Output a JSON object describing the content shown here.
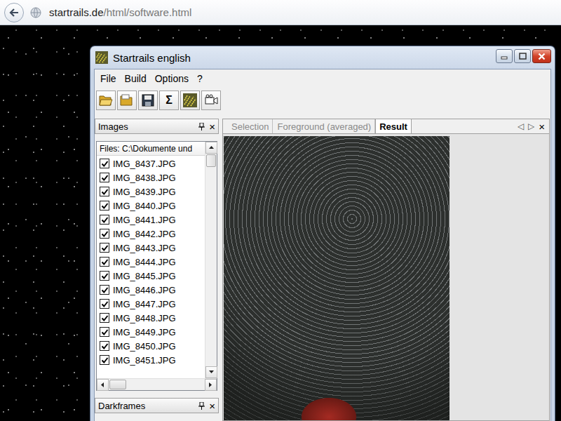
{
  "browser": {
    "url_host": "startrails.de",
    "url_path": "/html/software.html"
  },
  "window": {
    "title": "Startrails english"
  },
  "menu": [
    "File",
    "Build",
    "Options",
    "?"
  ],
  "toolbar": [
    {
      "kind": "open"
    },
    {
      "kind": "open-multiple"
    },
    {
      "kind": "save"
    },
    {
      "kind": "sum",
      "label": "Σ"
    },
    {
      "kind": "build"
    },
    {
      "kind": "video"
    }
  ],
  "images_panel": {
    "title": "Images",
    "close": "×",
    "files_header": "Files: C:\\Dokumente und",
    "files": [
      {
        "name": "IMG_8437.JPG",
        "checked": true
      },
      {
        "name": "IMG_8438.JPG",
        "checked": true
      },
      {
        "name": "IMG_8439.JPG",
        "checked": true
      },
      {
        "name": "IMG_8440.JPG",
        "checked": true
      },
      {
        "name": "IMG_8441.JPG",
        "checked": true
      },
      {
        "name": "IMG_8442.JPG",
        "checked": true
      },
      {
        "name": "IMG_8443.JPG",
        "checked": true
      },
      {
        "name": "IMG_8444.JPG",
        "checked": true
      },
      {
        "name": "IMG_8445.JPG",
        "checked": true
      },
      {
        "name": "IMG_8446.JPG",
        "checked": true
      },
      {
        "name": "IMG_8447.JPG",
        "checked": true
      },
      {
        "name": "IMG_8448.JPG",
        "checked": true
      },
      {
        "name": "IMG_8449.JPG",
        "checked": true
      },
      {
        "name": "IMG_8450.JPG",
        "checked": true
      },
      {
        "name": "IMG_8451.JPG",
        "checked": true
      }
    ]
  },
  "darkframes_panel": {
    "title": "Darkframes",
    "close": "×"
  },
  "tabs": [
    {
      "label": "Selection",
      "selected": false
    },
    {
      "label": "Foreground (averaged)",
      "selected": false
    },
    {
      "label": "Result",
      "selected": true
    }
  ],
  "tab_nav": {
    "prev": "◁",
    "next": "▷",
    "close": "×"
  }
}
